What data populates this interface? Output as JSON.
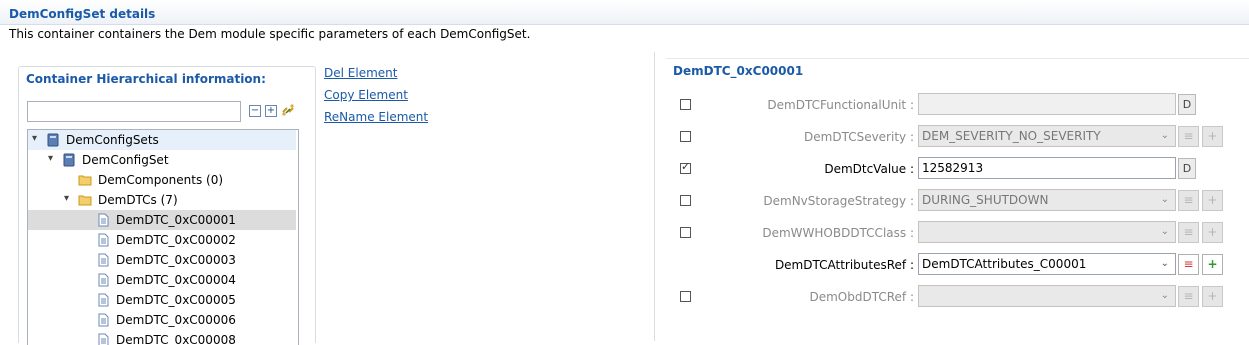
{
  "header": {
    "title": "DemConfigSet details",
    "description": "This container containers the Dem module specific parameters of each DemConfigSet."
  },
  "tree_panel": {
    "title": "Container Hierarchical information:",
    "filter_value": "",
    "collapse_label": "−",
    "expand_label": "+",
    "items": [
      {
        "label": "DemConfigSets",
        "twisty": "▾"
      },
      {
        "label": "DemConfigSet",
        "twisty": "▾"
      },
      {
        "label": "DemComponents (0)",
        "twisty": ""
      },
      {
        "label": "DemDTCs (7)",
        "twisty": "▾"
      },
      {
        "label": "DemDTC_0xC00001",
        "twisty": ""
      },
      {
        "label": "DemDTC_0xC00002",
        "twisty": ""
      },
      {
        "label": "DemDTC_0xC00003",
        "twisty": ""
      },
      {
        "label": "DemDTC_0xC00004",
        "twisty": ""
      },
      {
        "label": "DemDTC_0xC00005",
        "twisty": ""
      },
      {
        "label": "DemDTC_0xC00006",
        "twisty": ""
      },
      {
        "label": "DemDTC_0xC00008",
        "twisty": ""
      }
    ]
  },
  "actions": {
    "del": "Del Element",
    "copy": "Copy Element",
    "rename": "ReName Element"
  },
  "details": {
    "title": "DemDTC_0xC00001",
    "d_button": "D",
    "list_icon": "≡",
    "add_icon": "+",
    "dropdown_icon": "⌄",
    "rows": [
      {
        "label": "DemDTCFunctionalUnit :",
        "value": "",
        "checked": false
      },
      {
        "label": "DemDTCSeverity :",
        "value": "DEM_SEVERITY_NO_SEVERITY",
        "checked": false
      },
      {
        "label": "DemDtcValue :",
        "value": "12582913",
        "checked": true
      },
      {
        "label": "DemNvStorageStrategy :",
        "value": "DURING_SHUTDOWN",
        "checked": false
      },
      {
        "label": "DemWWHOBDDTCClass :",
        "value": "",
        "checked": false
      },
      {
        "label": "DemDTCAttributesRef :",
        "value": "DemDTCAttributes_C00001"
      },
      {
        "label": "DemObdDTCRef :",
        "value": "",
        "checked": false
      }
    ]
  },
  "colors": {
    "accent": "#1a5aa8",
    "selection": "#dcdcdc",
    "disabled_text": "#8a8a8a",
    "add_icon_green": "#2e9a2e",
    "list_icon_red": "#d23a3a"
  },
  "icons": {
    "folder": "folder-icon",
    "document": "document-icon",
    "database": "database-icon",
    "link_sync": "link-sync-icon"
  }
}
